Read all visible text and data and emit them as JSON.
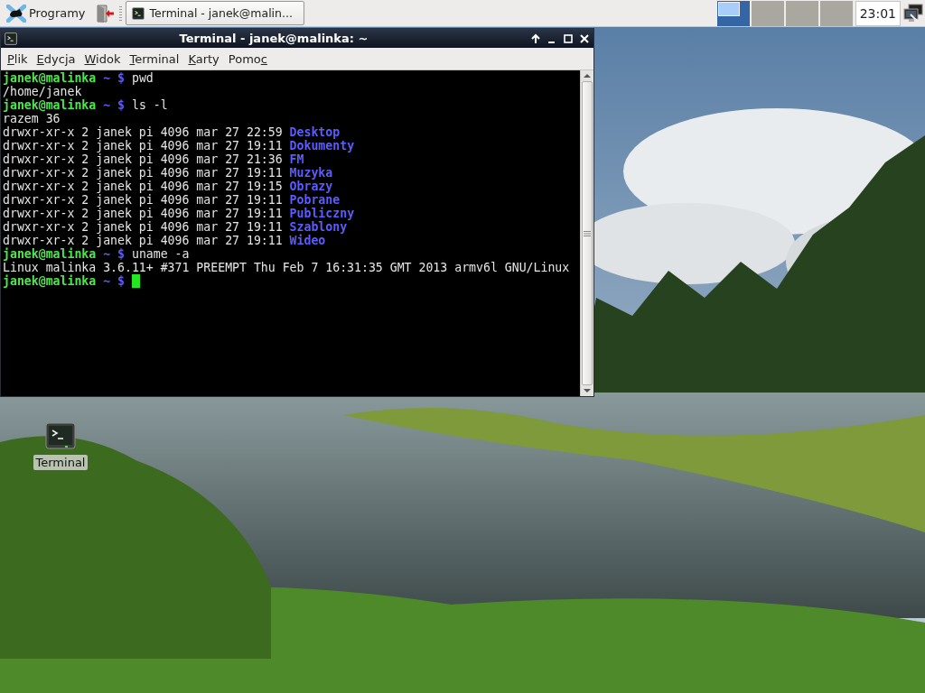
{
  "taskbar": {
    "menu_button": {
      "label": "Programy"
    },
    "tasks": [
      {
        "label": "Terminal - janek@malin...",
        "selected": true
      }
    ],
    "desktops": [
      {
        "selected": true
      },
      {
        "selected": false
      },
      {
        "selected": false
      },
      {
        "selected": false
      }
    ],
    "clock": "23:01"
  },
  "window": {
    "title": "Terminal - janek@malinka: ~",
    "menu": [
      {
        "key": "P",
        "after": "lik"
      },
      {
        "key": "E",
        "after": "dycja"
      },
      {
        "key": "W",
        "after": "idok"
      },
      {
        "key": "T",
        "after": "erminal"
      },
      {
        "key": "K",
        "after": "arty"
      },
      {
        "before": "Pomo",
        "key": "c"
      }
    ],
    "lines": [
      {
        "kind": "prompt",
        "user": "janek@malinka",
        "path": "~ $",
        "command": "pwd",
        "cursor": false
      },
      {
        "kind": "output",
        "text": "/home/janek"
      },
      {
        "kind": "prompt",
        "user": "janek@malinka",
        "path": "~ $",
        "command": "ls -l",
        "cursor": false
      },
      {
        "kind": "output",
        "text": "razem 36"
      },
      {
        "kind": "entry",
        "text": "drwxr-xr-x 2 janek pi 4096 mar 27 22:59",
        "name": "Desktop"
      },
      {
        "kind": "entry",
        "text": "drwxr-xr-x 2 janek pi 4096 mar 27 19:11",
        "name": "Dokumenty"
      },
      {
        "kind": "entry",
        "text": "drwxr-xr-x 2 janek pi 4096 mar 27 21:36",
        "name": "FM"
      },
      {
        "kind": "entry",
        "text": "drwxr-xr-x 2 janek pi 4096 mar 27 19:11",
        "name": "Muzyka"
      },
      {
        "kind": "entry",
        "text": "drwxr-xr-x 2 janek pi 4096 mar 27 19:15",
        "name": "Obrazy"
      },
      {
        "kind": "entry",
        "text": "drwxr-xr-x 2 janek pi 4096 mar 27 19:11",
        "name": "Pobrane"
      },
      {
        "kind": "entry",
        "text": "drwxr-xr-x 2 janek pi 4096 mar 27 19:11",
        "name": "Publiczny"
      },
      {
        "kind": "entry",
        "text": "drwxr-xr-x 2 janek pi 4096 mar 27 19:11",
        "name": "Szablony"
      },
      {
        "kind": "entry",
        "text": "drwxr-xr-x 2 janek pi 4096 mar 27 19:11",
        "name": "Wideo"
      },
      {
        "kind": "prompt",
        "user": "janek@malinka",
        "path": "~ $",
        "command": "uname -a",
        "cursor": false
      },
      {
        "kind": "output",
        "text": "Linux malinka 3.6.11+ #371 PREEMPT Thu Feb 7 16:31:35 GMT 2013 armv6l GNU/Linux"
      },
      {
        "kind": "prompt",
        "user": "janek@malinka",
        "path": "~ $",
        "cursor": true
      }
    ]
  },
  "desktop_icons": [
    {
      "label": "Terminal"
    }
  ]
}
